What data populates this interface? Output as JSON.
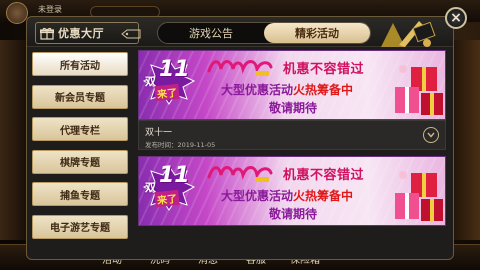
{
  "background": {
    "username": "未登录",
    "bottom_nav": [
      "活动",
      "洗码",
      "消息",
      "客服",
      "保险箱"
    ]
  },
  "modal": {
    "hall_label": "优惠大厅",
    "tabs": [
      {
        "label": "游戏公告",
        "active": false
      },
      {
        "label": "精彩活动",
        "active": true
      }
    ],
    "close_icon": "×"
  },
  "menu": {
    "items": [
      {
        "label": "所有活动",
        "active": true
      },
      {
        "label": "新会员专题",
        "active": false
      },
      {
        "label": "代理专栏",
        "active": false
      },
      {
        "label": "棋牌专题",
        "active": false
      },
      {
        "label": "捕鱼专题",
        "active": false
      },
      {
        "label": "电子游艺专题",
        "active": false
      }
    ]
  },
  "promotions": [
    {
      "badge_line1": "双",
      "badge_number": "11",
      "badge_line2": "来了",
      "headline": "机惠不容错过",
      "line2_pre": "大型优惠活动",
      "line2_hot": "火热筹备中",
      "line3": "敬请期待",
      "title": "双十一",
      "date": "发布时间：2019-11-05"
    },
    {
      "badge_line1": "双",
      "badge_number": "11",
      "badge_line2": "来了",
      "headline": "机惠不容错过",
      "line2_pre": "大型优惠活动",
      "line2_hot": "火热筹备中",
      "line3": "敬请期待"
    }
  ],
  "colors": {
    "accent_gold": "#d8bf90",
    "banner_purple": "#c548c8",
    "headline_red": "#d01060"
  }
}
